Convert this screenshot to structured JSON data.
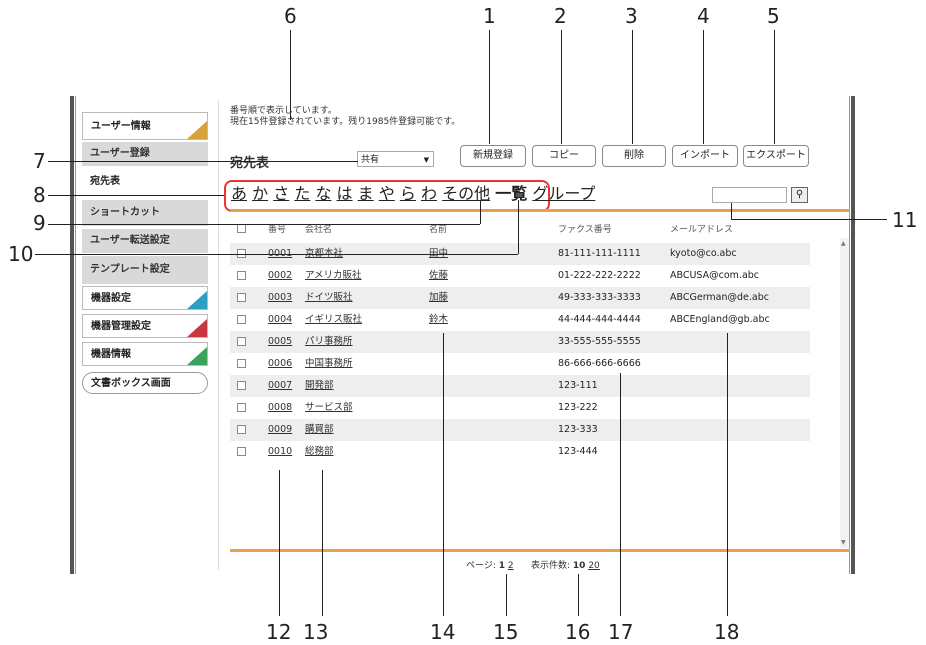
{
  "callouts": [
    "1",
    "2",
    "3",
    "4",
    "5",
    "6",
    "7",
    "8",
    "9",
    "10",
    "11",
    "12",
    "13",
    "14",
    "15",
    "16",
    "17",
    "18"
  ],
  "sidebar": {
    "items": [
      {
        "label": "ユーザー情報"
      },
      {
        "label": "ユーザー登録"
      },
      {
        "label": "宛先表"
      },
      {
        "label": "ショートカット"
      },
      {
        "label": "ユーザー転送設定"
      },
      {
        "label": "テンプレート設定"
      },
      {
        "label": "機器設定"
      },
      {
        "label": "機器管理設定"
      },
      {
        "label": "機器情報"
      }
    ],
    "button": "文書ボックス画面",
    "corner_colors": {
      "user_info": "#d9a13a",
      "device": "#2e9fc4",
      "device_mgmt": "#c9363e",
      "device_info": "#3aa25a"
    }
  },
  "message": {
    "line1": "番号順で表示しています。",
    "line2": "現在15件登録されています。残り1985件登録可能です。"
  },
  "page_title": "宛先表",
  "filter": {
    "selected": "共有"
  },
  "toolbar": {
    "new": "新規登録",
    "copy": "コピー",
    "delete": "削除",
    "import": "インポート",
    "export": "エクスポート"
  },
  "kana_index": [
    "あ",
    "か",
    "さ",
    "た",
    "な",
    "は",
    "ま",
    "や",
    "ら",
    "わ",
    "その他",
    "一覧",
    "グループ"
  ],
  "table": {
    "headers": {
      "no": "番号",
      "company": "会社名",
      "name": "名前",
      "fax": "ファクス番号",
      "email": "メールアドレス"
    },
    "rows": [
      {
        "no": "0001",
        "company": "京都本社",
        "name": "田中",
        "fax": "81-111-111-1111",
        "email": "kyoto@co.abc"
      },
      {
        "no": "0002",
        "company": "アメリカ販社",
        "name": "佐藤",
        "fax": "01-222-222-2222",
        "email": "ABCUSA@com.abc"
      },
      {
        "no": "0003",
        "company": "ドイツ販社",
        "name": "加藤",
        "fax": "49-333-333-3333",
        "email": "ABCGerman@de.abc"
      },
      {
        "no": "0004",
        "company": "イギリス販社",
        "name": "鈴木",
        "fax": "44-444-444-4444",
        "email": "ABCEngland@gb.abc"
      },
      {
        "no": "0005",
        "company": "パリ事務所",
        "name": "",
        "fax": "33-555-555-5555",
        "email": ""
      },
      {
        "no": "0006",
        "company": "中国事務所",
        "name": "",
        "fax": "86-666-666-6666",
        "email": ""
      },
      {
        "no": "0007",
        "company": "開発部",
        "name": "",
        "fax": "123-111",
        "email": ""
      },
      {
        "no": "0008",
        "company": "サービス部",
        "name": "",
        "fax": "123-222",
        "email": ""
      },
      {
        "no": "0009",
        "company": "購買部",
        "name": "",
        "fax": "123-333",
        "email": ""
      },
      {
        "no": "0010",
        "company": "総務部",
        "name": "",
        "fax": "123-444",
        "email": ""
      }
    ]
  },
  "pager": {
    "page_label": "ページ:",
    "page_current": "1",
    "page_next": "2",
    "count_label": "表示件数:",
    "count_current": "10",
    "count_other": "20"
  }
}
